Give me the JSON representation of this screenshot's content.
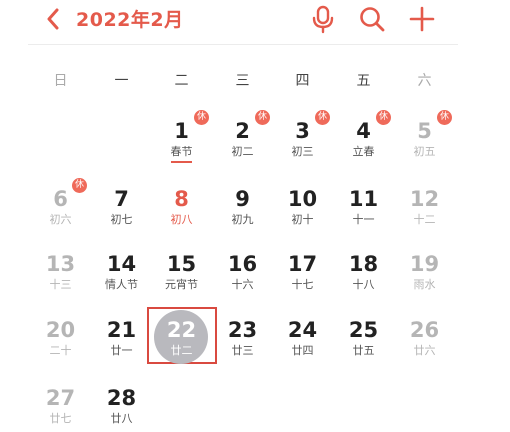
{
  "header": {
    "title": "2022年2月",
    "back_icon": "chevron-left-icon",
    "mic_icon": "microphone-icon",
    "search_icon": "search-icon",
    "add_icon": "plus-icon",
    "accent_color": "#e45a4b"
  },
  "weekdays": [
    "日",
    "一",
    "二",
    "三",
    "四",
    "五",
    "六"
  ],
  "rest_badge_label": "休",
  "selected_day": "22",
  "days": [
    {
      "num": "1",
      "lunar": "春节"
    },
    {
      "num": "2",
      "lunar": "初二"
    },
    {
      "num": "3",
      "lunar": "初三"
    },
    {
      "num": "4",
      "lunar": "立春"
    },
    {
      "num": "5",
      "lunar": "初五"
    },
    {
      "num": "6",
      "lunar": "初六"
    },
    {
      "num": "7",
      "lunar": "初七"
    },
    {
      "num": "8",
      "lunar": "初八"
    },
    {
      "num": "9",
      "lunar": "初九"
    },
    {
      "num": "10",
      "lunar": "初十"
    },
    {
      "num": "11",
      "lunar": "十一"
    },
    {
      "num": "12",
      "lunar": "十二"
    },
    {
      "num": "13",
      "lunar": "十三"
    },
    {
      "num": "14",
      "lunar": "情人节"
    },
    {
      "num": "15",
      "lunar": "元宵节"
    },
    {
      "num": "16",
      "lunar": "十六"
    },
    {
      "num": "17",
      "lunar": "十七"
    },
    {
      "num": "18",
      "lunar": "十八"
    },
    {
      "num": "19",
      "lunar": "雨水"
    },
    {
      "num": "20",
      "lunar": "二十"
    },
    {
      "num": "21",
      "lunar": "廿一"
    },
    {
      "num": "22",
      "lunar": "廿二"
    },
    {
      "num": "23",
      "lunar": "廿三"
    },
    {
      "num": "24",
      "lunar": "廿四"
    },
    {
      "num": "25",
      "lunar": "廿五"
    },
    {
      "num": "26",
      "lunar": "廿六"
    },
    {
      "num": "27",
      "lunar": "廿七"
    },
    {
      "num": "28",
      "lunar": "廿八"
    }
  ]
}
